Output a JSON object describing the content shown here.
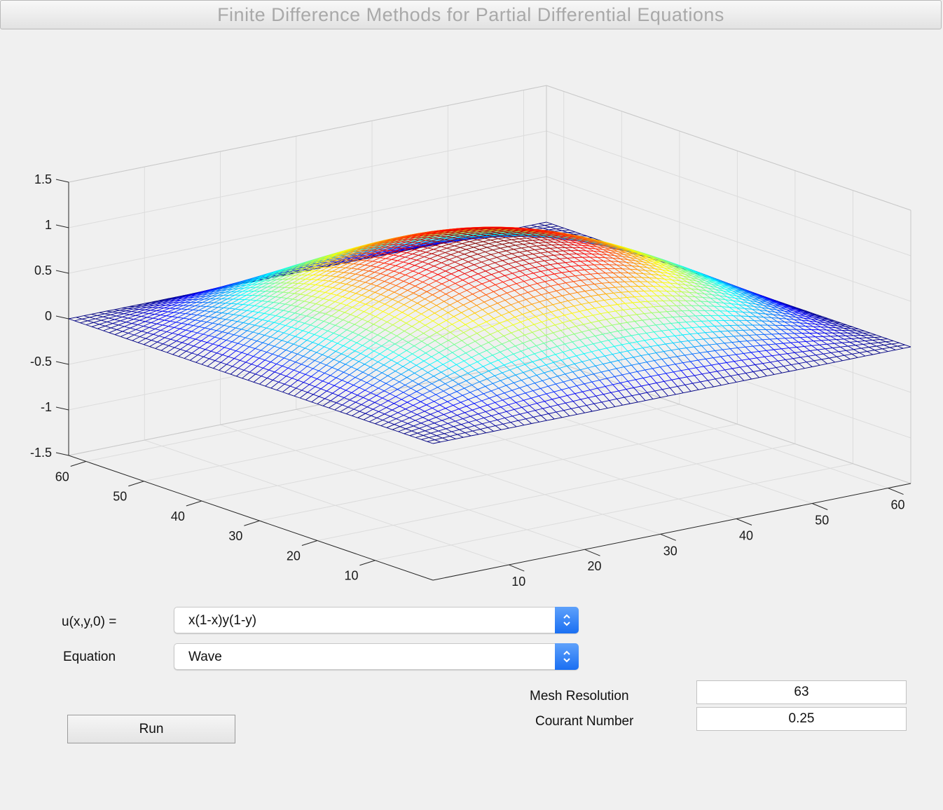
{
  "window": {
    "title": "Finite Difference Methods for Partial Differential Equations"
  },
  "chart_data": {
    "type": "surface",
    "mesh": 63,
    "surface": "sin(pi x) sin(pi y) scaled",
    "z_ticks": [
      "1.5",
      "1",
      "0.5",
      "0",
      "-0.5",
      "-1",
      "-1.5"
    ],
    "z_tick_values": [
      1.5,
      1,
      0.5,
      0,
      -0.5,
      -1,
      -1.5
    ],
    "zlim": [
      -1.5,
      1.5
    ],
    "zmax": 1.0,
    "x_ticks": [
      "10",
      "20",
      "30",
      "40",
      "50",
      "60"
    ],
    "x_tick_values": [
      10,
      20,
      30,
      40,
      50,
      60
    ],
    "y_ticks": [
      "10",
      "20",
      "30",
      "40",
      "50",
      "60"
    ],
    "y_tick_values": [
      10,
      20,
      30,
      40,
      50,
      60
    ],
    "xlim": [
      0,
      63
    ],
    "ylim": [
      0,
      63
    ],
    "grid": true,
    "colormap": "jet"
  },
  "controls": {
    "initial_label": "u(x,y,0) =",
    "initial_value": "x(1-x)y(1-y)",
    "equation_label": "Equation",
    "equation_value": "Wave",
    "mesh_label": "Mesh Resolution",
    "mesh_value": "63",
    "courant_label": "Courant Number",
    "courant_value": "0.25",
    "run_label": "Run"
  }
}
